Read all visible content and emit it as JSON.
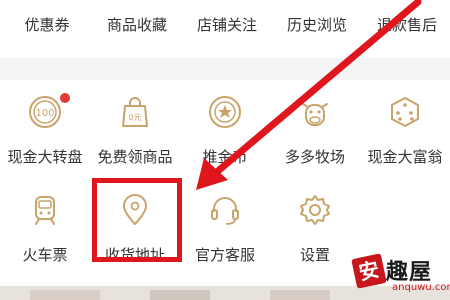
{
  "top_nav": {
    "items": [
      {
        "label": "优惠券"
      },
      {
        "label": "商品收藏"
      },
      {
        "label": "店铺关注"
      },
      {
        "label": "历史浏览"
      },
      {
        "label": "退款售后"
      }
    ]
  },
  "services": {
    "items": [
      {
        "label": "现金大转盘",
        "icon": "coin-100-icon",
        "badge_dot": true
      },
      {
        "label": "免费领商品",
        "icon": "gift-bag-icon",
        "badge_dot": false
      },
      {
        "label": "推金币",
        "icon": "gold-coin-icon",
        "badge_dot": false
      },
      {
        "label": "多多牧场",
        "icon": "cow-icon",
        "badge_dot": false
      },
      {
        "label": "现金大富翁",
        "icon": "dice-icon",
        "badge_dot": false
      },
      {
        "label": "火车票",
        "icon": "train-icon",
        "badge_dot": false
      },
      {
        "label": "收货地址",
        "icon": "location-pin-icon",
        "badge_dot": false,
        "highlighted": true
      },
      {
        "label": "官方客服",
        "icon": "headset-icon",
        "badge_dot": false
      },
      {
        "label": "设置",
        "icon": "gear-icon",
        "badge_dot": false
      }
    ]
  },
  "annotation": {
    "color": "#e0161e"
  },
  "watermark": {
    "badge": "安",
    "text": "趣屋",
    "url": "anquwu.com"
  },
  "colors": {
    "accent_red": "#e53935",
    "icon_gold": "#c9a46a",
    "text": "#333333"
  }
}
